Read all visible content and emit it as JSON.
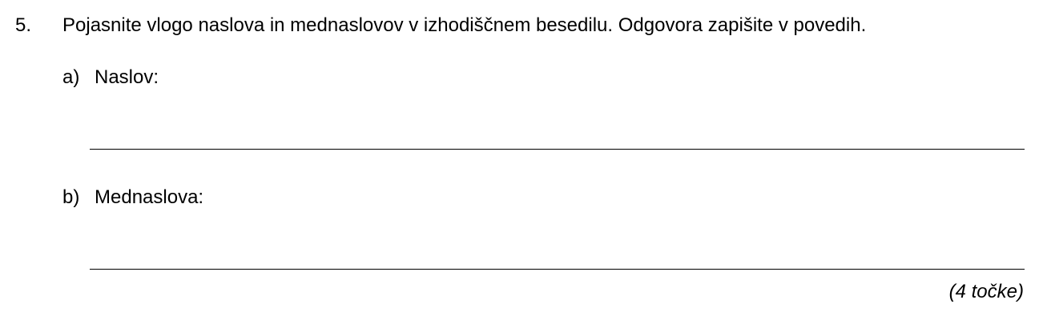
{
  "question": {
    "number": "5.",
    "text": "Pojasnite vlogo naslova in mednaslovov v izhodiščnem besedilu. Odgovora zapišite v povedih."
  },
  "parts": [
    {
      "letter": "a)",
      "label": "Naslov:"
    },
    {
      "letter": "b)",
      "label": "Mednaslova:"
    }
  ],
  "points": "(4 točke)"
}
